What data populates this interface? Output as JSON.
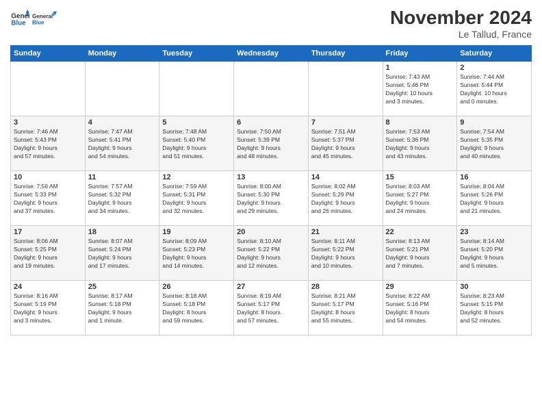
{
  "logo": {
    "line1": "General",
    "line2": "Blue"
  },
  "title": "November 2024",
  "location": "Le Tallud, France",
  "days_of_week": [
    "Sunday",
    "Monday",
    "Tuesday",
    "Wednesday",
    "Thursday",
    "Friday",
    "Saturday"
  ],
  "weeks": [
    [
      {
        "day": "",
        "info": ""
      },
      {
        "day": "",
        "info": ""
      },
      {
        "day": "",
        "info": ""
      },
      {
        "day": "",
        "info": ""
      },
      {
        "day": "",
        "info": ""
      },
      {
        "day": "1",
        "info": "Sunrise: 7:43 AM\nSunset: 5:46 PM\nDaylight: 10 hours\nand 3 minutes."
      },
      {
        "day": "2",
        "info": "Sunrise: 7:44 AM\nSunset: 5:44 PM\nDaylight: 10 hours\nand 0 minutes."
      }
    ],
    [
      {
        "day": "3",
        "info": "Sunrise: 7:46 AM\nSunset: 5:43 PM\nDaylight: 9 hours\nand 57 minutes."
      },
      {
        "day": "4",
        "info": "Sunrise: 7:47 AM\nSunset: 5:41 PM\nDaylight: 9 hours\nand 54 minutes."
      },
      {
        "day": "5",
        "info": "Sunrise: 7:48 AM\nSunset: 5:40 PM\nDaylight: 9 hours\nand 51 minutes."
      },
      {
        "day": "6",
        "info": "Sunrise: 7:50 AM\nSunset: 5:39 PM\nDaylight: 9 hours\nand 48 minutes."
      },
      {
        "day": "7",
        "info": "Sunrise: 7:51 AM\nSunset: 5:37 PM\nDaylight: 9 hours\nand 45 minutes."
      },
      {
        "day": "8",
        "info": "Sunrise: 7:53 AM\nSunset: 5:36 PM\nDaylight: 9 hours\nand 43 minutes."
      },
      {
        "day": "9",
        "info": "Sunrise: 7:54 AM\nSunset: 5:35 PM\nDaylight: 9 hours\nand 40 minutes."
      }
    ],
    [
      {
        "day": "10",
        "info": "Sunrise: 7:56 AM\nSunset: 5:33 PM\nDaylight: 9 hours\nand 37 minutes."
      },
      {
        "day": "11",
        "info": "Sunrise: 7:57 AM\nSunset: 5:32 PM\nDaylight: 9 hours\nand 34 minutes."
      },
      {
        "day": "12",
        "info": "Sunrise: 7:59 AM\nSunset: 5:31 PM\nDaylight: 9 hours\nand 32 minutes."
      },
      {
        "day": "13",
        "info": "Sunrise: 8:00 AM\nSunset: 5:30 PM\nDaylight: 9 hours\nand 29 minutes."
      },
      {
        "day": "14",
        "info": "Sunrise: 8:02 AM\nSunset: 5:29 PM\nDaylight: 9 hours\nand 26 minutes."
      },
      {
        "day": "15",
        "info": "Sunrise: 8:03 AM\nSunset: 5:27 PM\nDaylight: 9 hours\nand 24 minutes."
      },
      {
        "day": "16",
        "info": "Sunrise: 8:04 AM\nSunset: 5:26 PM\nDaylight: 9 hours\nand 21 minutes."
      }
    ],
    [
      {
        "day": "17",
        "info": "Sunrise: 8:06 AM\nSunset: 5:25 PM\nDaylight: 9 hours\nand 19 minutes."
      },
      {
        "day": "18",
        "info": "Sunrise: 8:07 AM\nSunset: 5:24 PM\nDaylight: 9 hours\nand 17 minutes."
      },
      {
        "day": "19",
        "info": "Sunrise: 8:09 AM\nSunset: 5:23 PM\nDaylight: 9 hours\nand 14 minutes."
      },
      {
        "day": "20",
        "info": "Sunrise: 8:10 AM\nSunset: 5:22 PM\nDaylight: 9 hours\nand 12 minutes."
      },
      {
        "day": "21",
        "info": "Sunrise: 8:11 AM\nSunset: 5:22 PM\nDaylight: 9 hours\nand 10 minutes."
      },
      {
        "day": "22",
        "info": "Sunrise: 8:13 AM\nSunset: 5:21 PM\nDaylight: 9 hours\nand 7 minutes."
      },
      {
        "day": "23",
        "info": "Sunrise: 8:14 AM\nSunset: 5:20 PM\nDaylight: 9 hours\nand 5 minutes."
      }
    ],
    [
      {
        "day": "24",
        "info": "Sunrise: 8:16 AM\nSunset: 5:19 PM\nDaylight: 9 hours\nand 3 minutes."
      },
      {
        "day": "25",
        "info": "Sunrise: 8:17 AM\nSunset: 5:18 PM\nDaylight: 9 hours\nand 1 minute."
      },
      {
        "day": "26",
        "info": "Sunrise: 8:18 AM\nSunset: 5:18 PM\nDaylight: 8 hours\nand 59 minutes."
      },
      {
        "day": "27",
        "info": "Sunrise: 8:19 AM\nSunset: 5:17 PM\nDaylight: 8 hours\nand 57 minutes."
      },
      {
        "day": "28",
        "info": "Sunrise: 8:21 AM\nSunset: 5:17 PM\nDaylight: 8 hours\nand 55 minutes."
      },
      {
        "day": "29",
        "info": "Sunrise: 8:22 AM\nSunset: 5:16 PM\nDaylight: 8 hours\nand 54 minutes."
      },
      {
        "day": "30",
        "info": "Sunrise: 8:23 AM\nSunset: 5:15 PM\nDaylight: 8 hours\nand 52 minutes."
      }
    ]
  ]
}
